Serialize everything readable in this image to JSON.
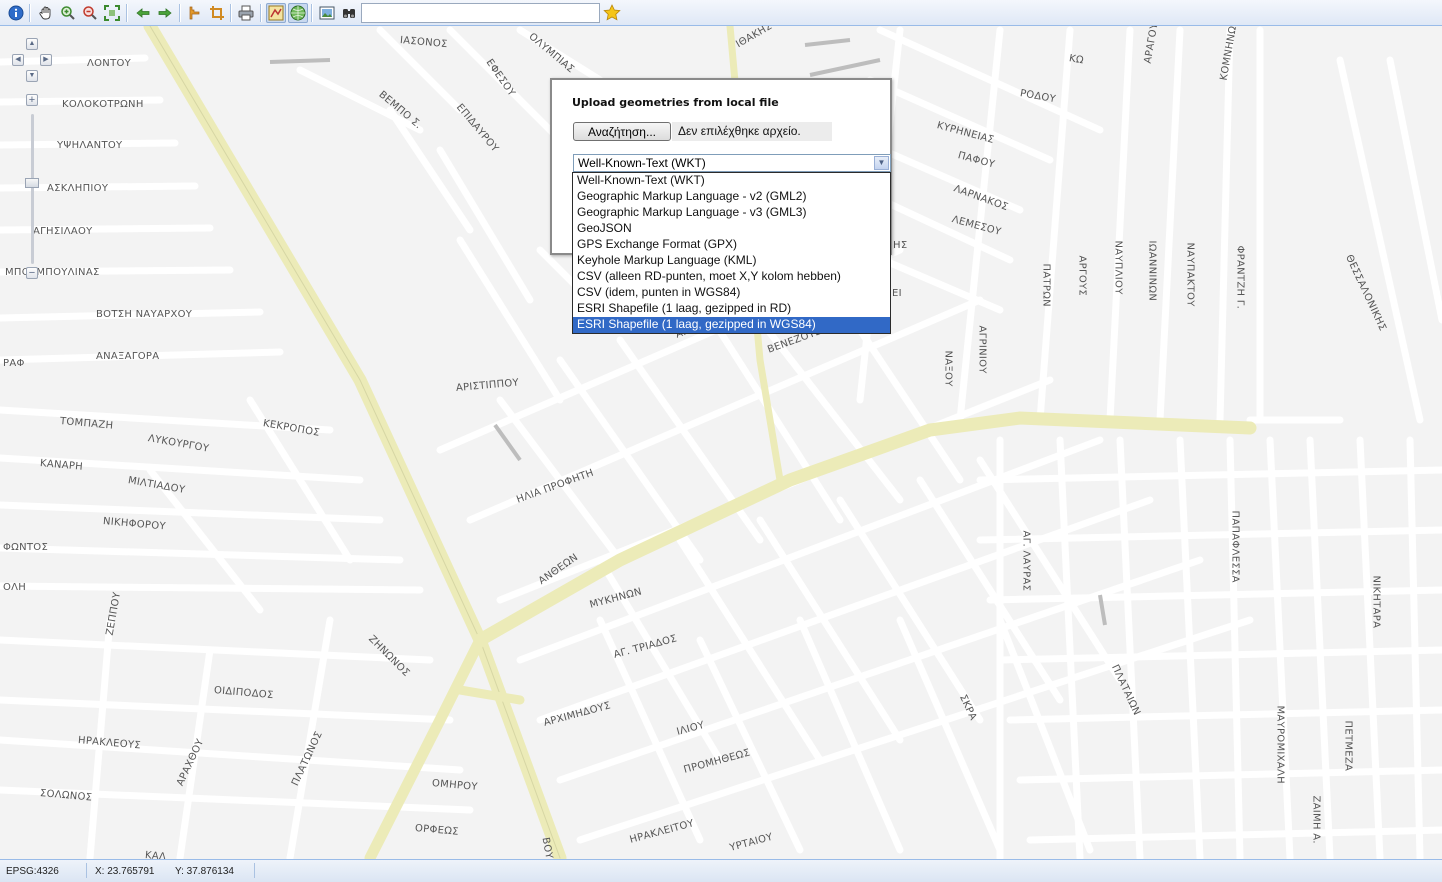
{
  "toolbar": {
    "buttons": [
      {
        "icon": "info-icon",
        "title": "Info"
      },
      {
        "icon": "pan-hand-icon",
        "title": "Pan"
      },
      {
        "icon": "zoom-in-icon",
        "title": "Zoom in"
      },
      {
        "icon": "zoom-out-icon",
        "title": "Zoom out"
      },
      {
        "icon": "zoom-extent-icon",
        "title": "Full extent"
      },
      {
        "icon": "back-arrow-icon",
        "title": "Previous extent"
      },
      {
        "icon": "forward-arrow-icon",
        "title": "Next extent"
      },
      {
        "icon": "measure-icon",
        "title": "Measure"
      },
      {
        "icon": "crop-icon",
        "title": "Select area"
      },
      {
        "icon": "print-icon",
        "title": "Print"
      },
      {
        "icon": "draw-geometry-icon",
        "title": "Draw geometry"
      },
      {
        "icon": "upload-globe-icon",
        "title": "Upload"
      },
      {
        "icon": "map-image-icon",
        "title": "Layers"
      },
      {
        "icon": "binoculars-icon",
        "title": "Find"
      },
      {
        "icon": "favorite-star-icon",
        "title": "Favorite"
      }
    ],
    "search_value": ""
  },
  "map": {
    "street_labels": [
      {
        "name": "ΙΑΣΟΝΟΣ"
      },
      {
        "name": "ΟΛΥΜΠΙΑΣ"
      },
      {
        "name": "ΕΦΕΣΟΥ"
      },
      {
        "name": "ΒΕΜΠΟ Σ."
      },
      {
        "name": "ΕΠΙΔΑΥΡΟΥ"
      },
      {
        "name": "ΛΟΝΤΟΥ"
      },
      {
        "name": "ΚΟΛΟΚΟΤΡΩΝΗ"
      },
      {
        "name": "ΥΨΗΛΑΝΤΟΥ"
      },
      {
        "name": "ΑΣΚΛΗΠΙΟΥ"
      },
      {
        "name": "ΑΓΗΣΙΛΑΟΥ"
      },
      {
        "name": "ΜΠΟΥΜΠΟΥΛΙΝΑΣ"
      },
      {
        "name": "ΒΟΤΣΗ ΝΑΥΑΡΧΟΥ"
      },
      {
        "name": "ΑΝΑΞΑΓΟΡΑ"
      },
      {
        "name": "ΡΑΦ"
      },
      {
        "name": "ΤΟΜΠΑΖΗ"
      },
      {
        "name": "ΛΥΚΟΥΡΓΟΥ"
      },
      {
        "name": "ΚΕΚΡΟΠΟΣ"
      },
      {
        "name": "ΚΑΝΑΡΗ"
      },
      {
        "name": "ΜΙΛΤΙΑΔΟΥ"
      },
      {
        "name": "ΝΙΚΗΦΟΡΟΥ"
      },
      {
        "name": "ΦΩΝΤΟΣ"
      },
      {
        "name": "ΟΛΗ"
      },
      {
        "name": "ΖΕΠΠΟΥ"
      },
      {
        "name": "ΖΗΝΩΝΟΣ"
      },
      {
        "name": "ΟΙΔΙΠΟΔΟΣ"
      },
      {
        "name": "ΗΡΑΚΛΕΟΥΣ"
      },
      {
        "name": "ΑΡΑΧΘΟΥ"
      },
      {
        "name": "ΠΛΑΤΩΝΟΣ"
      },
      {
        "name": "ΣΟΛΩΝΟΣ"
      },
      {
        "name": "ΟΜΗΡΟΥ"
      },
      {
        "name": "ΟΡΦΕΩΣ"
      },
      {
        "name": "ΑΡΙΣΤΙΠΠΟΥ"
      },
      {
        "name": "ΗΛΙΑ ΠΡΟΦΗΤΗ"
      },
      {
        "name": "ΑΝΘΕΩΝ"
      },
      {
        "name": "ΜΥΚΗΝΩΝ"
      },
      {
        "name": "ΑΓ. ΤΡΙΑΔΟΣ"
      },
      {
        "name": "ΑΡΧΙΜΗΔΟΥΣ"
      },
      {
        "name": "ΙΛΙΟΥ"
      },
      {
        "name": "ΠΡΟΜΗΘΕΩΣ"
      },
      {
        "name": "ΗΡΑΚΛΕΙΤΟΥ"
      },
      {
        "name": "ΥΡΤΑΙΟΥ"
      },
      {
        "name": "ΒΕΝΕΖΟΥΕΛΑΣ"
      },
      {
        "name": "ΑΡΙΣΤΕΙ"
      },
      {
        "name": "ΙΘΑΚΗΣ"
      },
      {
        "name": "ΚΩ"
      },
      {
        "name": "ΡΟΔΟΥ"
      },
      {
        "name": "ΚΥΡΗΝΕΙΑΣ"
      },
      {
        "name": "ΠΑΦΟΥ"
      },
      {
        "name": "ΛΑΡΝΑΚΟΣ"
      },
      {
        "name": "ΛΕΜΕΣΟΥ"
      },
      {
        "name": "ΑΡΑΓΟΥΜΗ Γ."
      },
      {
        "name": "ΚΟΜΝΗΝΩΝ"
      },
      {
        "name": "ΠΑΤΡΩΝ"
      },
      {
        "name": "ΑΡΓΟΥΣ"
      },
      {
        "name": "ΝΑΥΠΛΙΟΥ"
      },
      {
        "name": "ΙΩΑΝΝΙΝΩΝ"
      },
      {
        "name": "ΝΑΥΠΑΚΤΟΥ"
      },
      {
        "name": "ΦΡΑΝΤΖΗ Γ."
      },
      {
        "name": "ΘΕΣΣΑΛΟΝΙΚΗΣ"
      },
      {
        "name": "ΑΓΡΙΝΙΟΥ"
      },
      {
        "name": "ΝΑΞΟΥ"
      },
      {
        "name": "ΑΓ. ΛΑΥΡΑΣ"
      },
      {
        "name": "ΠΑΠΑΦΛΕΣΣΑ"
      },
      {
        "name": "ΝΙΚΗΤΑΡΑ"
      },
      {
        "name": "ΠΛΑΤΑΙΩΝ"
      },
      {
        "name": "ΣΚΡΑ"
      },
      {
        "name": "ΜΑΥΡΟΜΙΧΑΛΗ"
      },
      {
        "name": "ΠΕΤΜΕΖΑ"
      },
      {
        "name": "ΖΑΙΜΗ Α."
      },
      {
        "name": "ΒΟΥ"
      },
      {
        "name": "ΚΑΛ"
      },
      {
        "name": "ΗΣ"
      },
      {
        "name": "ΕΙ"
      }
    ]
  },
  "upload_dialog": {
    "title": "Upload geometries from local file",
    "browse_label": "Αναζήτηση...",
    "file_status": "Δεν επιλέχθηκε αρχείο.",
    "selected_format": "Well-Known-Text (WKT)",
    "format_options": [
      "Well-Known-Text (WKT)",
      "Geographic Markup Language - v2 (GML2)",
      "Geographic Markup Language - v3 (GML3)",
      "GeoJSON",
      "GPS Exchange Format (GPX)",
      "Keyhole Markup Language (KML)",
      "CSV (alleen RD-punten, moet X,Y kolom hebben)",
      "CSV (idem, punten in WGS84)",
      "ESRI Shapefile (1 laag, gezipped in RD)",
      "ESRI Shapefile (1 laag, gezipped in WGS84)"
    ],
    "highlighted_option_index": 9
  },
  "statusbar": {
    "projection": "EPSG:4326",
    "x_coord": "X: 23.765791",
    "y_coord": "Y: 37.876134"
  }
}
